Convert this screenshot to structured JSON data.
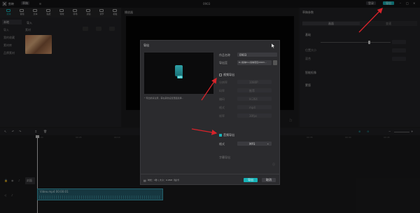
{
  "app": {
    "title": "剪映",
    "tag": "草稿",
    "project_name": "0903"
  },
  "titlebar": {
    "export_button": "导出",
    "login_button": "登录"
  },
  "media_tabs": [
    {
      "label": "媒体",
      "icon": "media-icon"
    },
    {
      "label": "音频",
      "icon": "audio-icon"
    },
    {
      "label": "文本",
      "icon": "text-icon"
    },
    {
      "label": "贴纸",
      "icon": "sticker-icon"
    },
    {
      "label": "特效",
      "icon": "effects-icon"
    },
    {
      "label": "转场",
      "icon": "transition-icon"
    },
    {
      "label": "滤镜",
      "icon": "filter-icon"
    },
    {
      "label": "调节",
      "icon": "adjust-icon"
    },
    {
      "label": "模板",
      "icon": "template-icon"
    }
  ],
  "left_sidebar": {
    "items": [
      "本地",
      "导入",
      "我的收藏",
      "素材库",
      "品牌素材"
    ]
  },
  "left_panel": {
    "import_label": "导入",
    "folder_label": "素材"
  },
  "preview": {
    "title": "播放器"
  },
  "right_panel": {
    "title": "草稿参数",
    "tabs": [
      "画面",
      "变速"
    ],
    "sections": [
      "基础",
      "位置大小",
      "混合",
      "智能抠像",
      "蒙版"
    ]
  },
  "dialog": {
    "title": "导出",
    "cover_edit_label": "编辑",
    "hint": "* 导出前请注意，需在其他设置里面选择...",
    "name_label": "作品名称",
    "name_value": "0903",
    "export_to_label": "导出至",
    "export_to_value": "D:/剪映Pro/剪映项目/0903...",
    "video_export_label": "视频导出",
    "video_export_checked": false,
    "video_rows": [
      {
        "label": "分辨率",
        "value": "1080P"
      },
      {
        "label": "码率",
        "value": "推荐"
      },
      {
        "label": "编码",
        "value": "H.264"
      },
      {
        "label": "格式",
        "value": "mp4"
      },
      {
        "label": "帧率",
        "value": "30fps"
      }
    ],
    "audio_export_label": "音频导出",
    "audio_export_checked": true,
    "format_label": "格式",
    "format_value": "MP3",
    "extra_label": "字幕导出",
    "footer_info": "时长：1秒 | 大小：0.05M（估计）",
    "export_button": "导出",
    "cancel_button": "取消"
  },
  "timeline": {
    "time_marks": [
      "00:00",
      "00:05",
      "00:10",
      "00:15",
      "00:20",
      "00:25",
      "00:30",
      "00:35",
      "00:40",
      "00:45"
    ],
    "cover_label": "封面",
    "clip_label": "Video.mp4  00:00:01"
  },
  "colors": {
    "accent": "#17b3b8",
    "arrow": "#d8232a"
  }
}
